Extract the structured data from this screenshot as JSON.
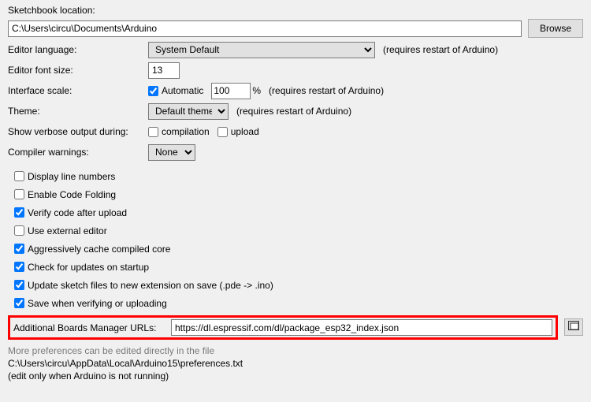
{
  "sketchbook": {
    "label": "Sketchbook location:",
    "value": "C:\\Users\\circu\\Documents\\Arduino",
    "browse": "Browse"
  },
  "editorLanguage": {
    "label": "Editor language:",
    "value": "System Default",
    "hint": "(requires restart of Arduino)"
  },
  "editorFontSize": {
    "label": "Editor font size:",
    "value": "13"
  },
  "interfaceScale": {
    "label": "Interface scale:",
    "autoChecked": true,
    "autoLabel": "Automatic",
    "value": "100",
    "percent": "%",
    "hint": "(requires restart of Arduino)"
  },
  "theme": {
    "label": "Theme:",
    "value": "Default theme",
    "hint": "(requires restart of Arduino)"
  },
  "verbose": {
    "label": "Show verbose output during:",
    "compilation": {
      "checked": false,
      "label": "compilation"
    },
    "upload": {
      "checked": false,
      "label": "upload"
    }
  },
  "compilerWarnings": {
    "label": "Compiler warnings:",
    "value": "None"
  },
  "options": {
    "displayLineNumbers": {
      "checked": false,
      "label": "Display line numbers"
    },
    "enableCodeFolding": {
      "checked": false,
      "label": "Enable Code Folding"
    },
    "verifyAfterUpload": {
      "checked": true,
      "label": "Verify code after upload"
    },
    "externalEditor": {
      "checked": false,
      "label": "Use external editor"
    },
    "cacheCore": {
      "checked": true,
      "label": "Aggressively cache compiled core"
    },
    "checkUpdates": {
      "checked": true,
      "label": "Check for updates on startup"
    },
    "updateSketchExt": {
      "checked": true,
      "label": "Update sketch files to new extension on save (.pde -> .ino)"
    },
    "saveOnVerifyUpload": {
      "checked": true,
      "label": "Save when verifying or uploading"
    }
  },
  "boardsUrls": {
    "label": "Additional Boards Manager URLs:",
    "value": "https://dl.espressif.com/dl/package_esp32_index.json"
  },
  "footer": {
    "line1": "More preferences can be edited directly in the file",
    "line2": "C:\\Users\\circu\\AppData\\Local\\Arduino15\\preferences.txt",
    "line3": "(edit only when Arduino is not running)"
  }
}
